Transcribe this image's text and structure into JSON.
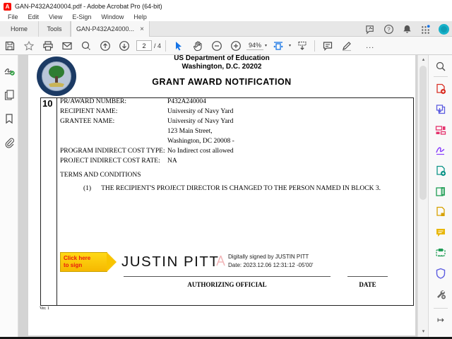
{
  "titlebar": {
    "title": "GAN-P432A240004.pdf - Adobe Acrobat Pro (64-bit)",
    "app_badge": "A"
  },
  "menubar": {
    "items": [
      "File",
      "Edit",
      "View",
      "E-Sign",
      "Window",
      "Help"
    ]
  },
  "tabs": {
    "home": "Home",
    "tools": "Tools",
    "document": "GAN-P432A24000...",
    "close_glyph": "×"
  },
  "toolbar": {
    "page_current": "2",
    "page_total": "/ 4",
    "zoom_level": "94%",
    "caret_glyph": "▾",
    "more_glyph": "..."
  },
  "scrollbar": {
    "up_glyph": "▴",
    "down_glyph": "▾"
  },
  "rightrail": {
    "open_pane_glyph": "↦"
  },
  "document": {
    "header_line1": "US Department of Education",
    "header_line2": "Washington, D.C. 20202",
    "header_line3": "GRANT AWARD NOTIFICATION",
    "block_number": "10",
    "fields": [
      {
        "label": "PR/AWARD NUMBER:",
        "value": "P432A240004"
      },
      {
        "label": "RECIPIENT NAME:",
        "value": "University of Navy Yard"
      },
      {
        "label": "GRANTEE NAME:",
        "value": "University of Navy Yard"
      },
      {
        "label": "",
        "value": "123 Main Street,"
      },
      {
        "label": "",
        "value": "Washington, DC 20008 -"
      },
      {
        "label": "PROGRAM INDIRECT COST TYPE:",
        "value": "No Indirect cost allowed"
      },
      {
        "label": "PROJECT INDIRECT COST RATE:",
        "value": "NA"
      }
    ],
    "terms_heading": "TERMS AND CONDITIONS",
    "terms_item_number": "(1)",
    "terms_item_text": "THE RECIPIENT'S PROJECT DIRECTOR IS CHANGED TO THE PERSON NAMED IN BLOCK 3.",
    "sign_tag_line1": "Click here",
    "sign_tag_line2": "to sign",
    "signature_name": "JUSTIN PITT",
    "digital_signature_line1": "Digitally signed by JUSTIN PITT",
    "digital_signature_line2": "Date: 2023.12.06 12:31:12 -05'00'",
    "authorizing_label": "AUTHORIZING OFFICIAL",
    "date_label": "DATE",
    "version": "Ver. 1"
  },
  "colors": {
    "acrobat_red": "#fa0f00",
    "accent_blue": "#1473e6",
    "sign_tag_yellow": "#ffd916",
    "sign_tag_text_red": "#e8190f",
    "avatar_teal": "#17b1c9"
  }
}
